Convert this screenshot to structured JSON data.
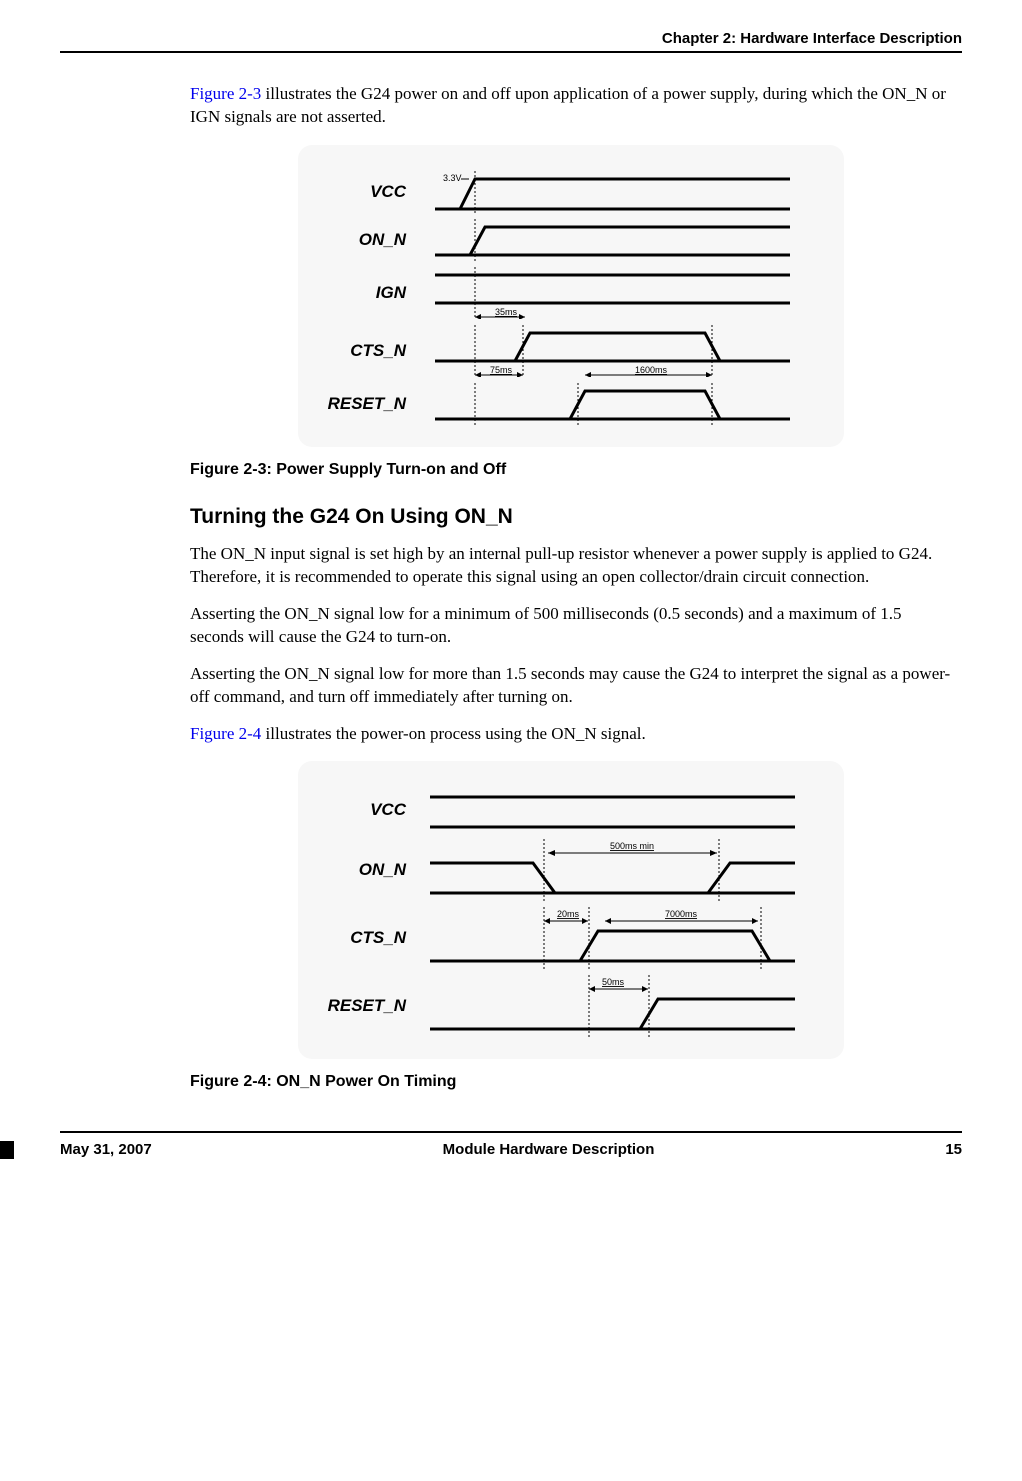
{
  "header": {
    "chapter": "Chapter 2:  Hardware Interface Description"
  },
  "body": {
    "p1_link": "Figure 2-3",
    "p1_rest": " illustrates the G24 power on and off upon application of a power supply, during which the ON_N or IGN signals are not asserted.",
    "fig1": {
      "caption": "Figure 2-3: Power Supply Turn-on and Off",
      "signals": {
        "vcc": "VCC",
        "on_n": "ON_N",
        "ign": "IGN",
        "cts_n": "CTS_N",
        "reset_n": "RESET_N"
      },
      "annotations": {
        "vcc_level": "3.3V",
        "ign_time": "35ms",
        "cts_t1": "75ms",
        "cts_t2": "1600ms"
      }
    },
    "heading": "Turning the G24 On Using ON_N",
    "p2": "The ON_N input signal is set high by an internal pull-up resistor whenever a power supply is applied to G24. Therefore, it is recommended to operate this signal using an open collector/drain circuit connection.",
    "p3": "Asserting the ON_N signal low for a minimum of 500 milliseconds (0.5 seconds) and a maximum of 1.5 seconds will cause the G24 to turn-on.",
    "p4": "Asserting the ON_N signal low for more than 1.5 seconds may cause the G24 to interpret the signal as a power-off command, and turn off immediately after turning on.",
    "p5_link": "Figure 2-4",
    "p5_rest": " illustrates the power-on process using the ON_N signal.",
    "fig2": {
      "caption": "Figure 2-4: ON_N Power On Timing",
      "signals": {
        "vcc": "VCC",
        "on_n": "ON_N",
        "cts_n": "CTS_N",
        "reset_n": "RESET_N"
      },
      "annotations": {
        "on_n_min": "500ms min",
        "cts_t1": "20ms",
        "cts_t2": "7000ms",
        "reset_t": "50ms"
      }
    }
  },
  "footer": {
    "date": "May 31, 2007",
    "title": "Module Hardware Description",
    "page": "15"
  },
  "chart_data": [
    {
      "type": "timing",
      "title": "Figure 2-3: Power Supply Turn-on and Off",
      "signals": [
        "VCC",
        "ON_N",
        "IGN",
        "CTS_N",
        "RESET_N"
      ],
      "annotations": [
        {
          "signal": "VCC",
          "label": "3.3V",
          "type": "level"
        },
        {
          "signal": "IGN",
          "label": "35ms",
          "type": "interval"
        },
        {
          "signal": "CTS_N",
          "label": "75ms",
          "type": "interval"
        },
        {
          "signal": "CTS_N",
          "label": "1600ms",
          "type": "interval"
        }
      ]
    },
    {
      "type": "timing",
      "title": "Figure 2-4: ON_N Power On Timing",
      "signals": [
        "VCC",
        "ON_N",
        "CTS_N",
        "RESET_N"
      ],
      "annotations": [
        {
          "signal": "ON_N",
          "label": "500ms min",
          "type": "interval"
        },
        {
          "signal": "CTS_N",
          "label": "20ms",
          "type": "interval"
        },
        {
          "signal": "CTS_N",
          "label": "7000ms",
          "type": "interval"
        },
        {
          "signal": "RESET_N",
          "label": "50ms",
          "type": "interval"
        }
      ]
    }
  ]
}
